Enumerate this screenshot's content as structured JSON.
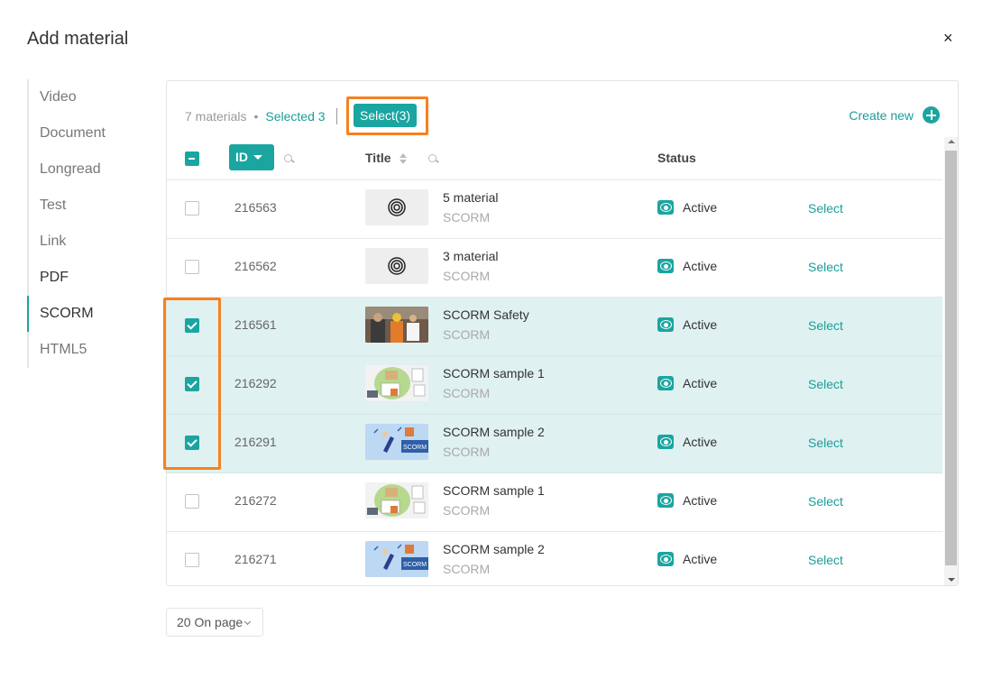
{
  "dialog": {
    "title": "Add material",
    "close_label": "×"
  },
  "sidebar": {
    "items": [
      {
        "label": "Video"
      },
      {
        "label": "Document"
      },
      {
        "label": "Longread"
      },
      {
        "label": "Test"
      },
      {
        "label": "Link"
      },
      {
        "label": "PDF"
      },
      {
        "label": "SCORM",
        "active": true
      },
      {
        "label": "HTML5"
      }
    ]
  },
  "toolbar": {
    "count_label": "7 materials",
    "separator": "•",
    "selected_label": "Selected 3",
    "select_button_label": "Select(3)",
    "create_new_label": "Create new"
  },
  "table": {
    "columns": {
      "id": "ID",
      "title": "Title",
      "status": "Status"
    },
    "rows": [
      {
        "id": "216563",
        "name": "5 material",
        "type": "SCORM",
        "status": "Active",
        "action": "Select",
        "checked": false,
        "thumb": "target-icon"
      },
      {
        "id": "216562",
        "name": "3 material",
        "type": "SCORM",
        "status": "Active",
        "action": "Select",
        "checked": false,
        "thumb": "target-icon"
      },
      {
        "id": "216561",
        "name": "SCORM Safety",
        "type": "SCORM",
        "status": "Active",
        "action": "Select",
        "checked": true,
        "thumb": "photo"
      },
      {
        "id": "216292",
        "name": "SCORM sample 1",
        "type": "SCORM",
        "status": "Active",
        "action": "Select",
        "checked": true,
        "thumb": "illustration-green"
      },
      {
        "id": "216291",
        "name": "SCORM sample 2",
        "type": "SCORM",
        "status": "Active",
        "action": "Select",
        "checked": true,
        "thumb": "illustration-blue"
      },
      {
        "id": "216272",
        "name": "SCORM sample 1",
        "type": "SCORM",
        "status": "Active",
        "action": "Select",
        "checked": false,
        "thumb": "illustration-green"
      },
      {
        "id": "216271",
        "name": "SCORM sample 2",
        "type": "SCORM",
        "status": "Active",
        "action": "Select",
        "checked": false,
        "thumb": "illustration-blue"
      }
    ],
    "thumb_blue_text": "SCORM"
  },
  "pager": {
    "per_page_label": "20 On page"
  },
  "colors": {
    "accent": "#1aa5a0",
    "highlight": "#f5821f",
    "selected_row": "#dff1f0"
  }
}
